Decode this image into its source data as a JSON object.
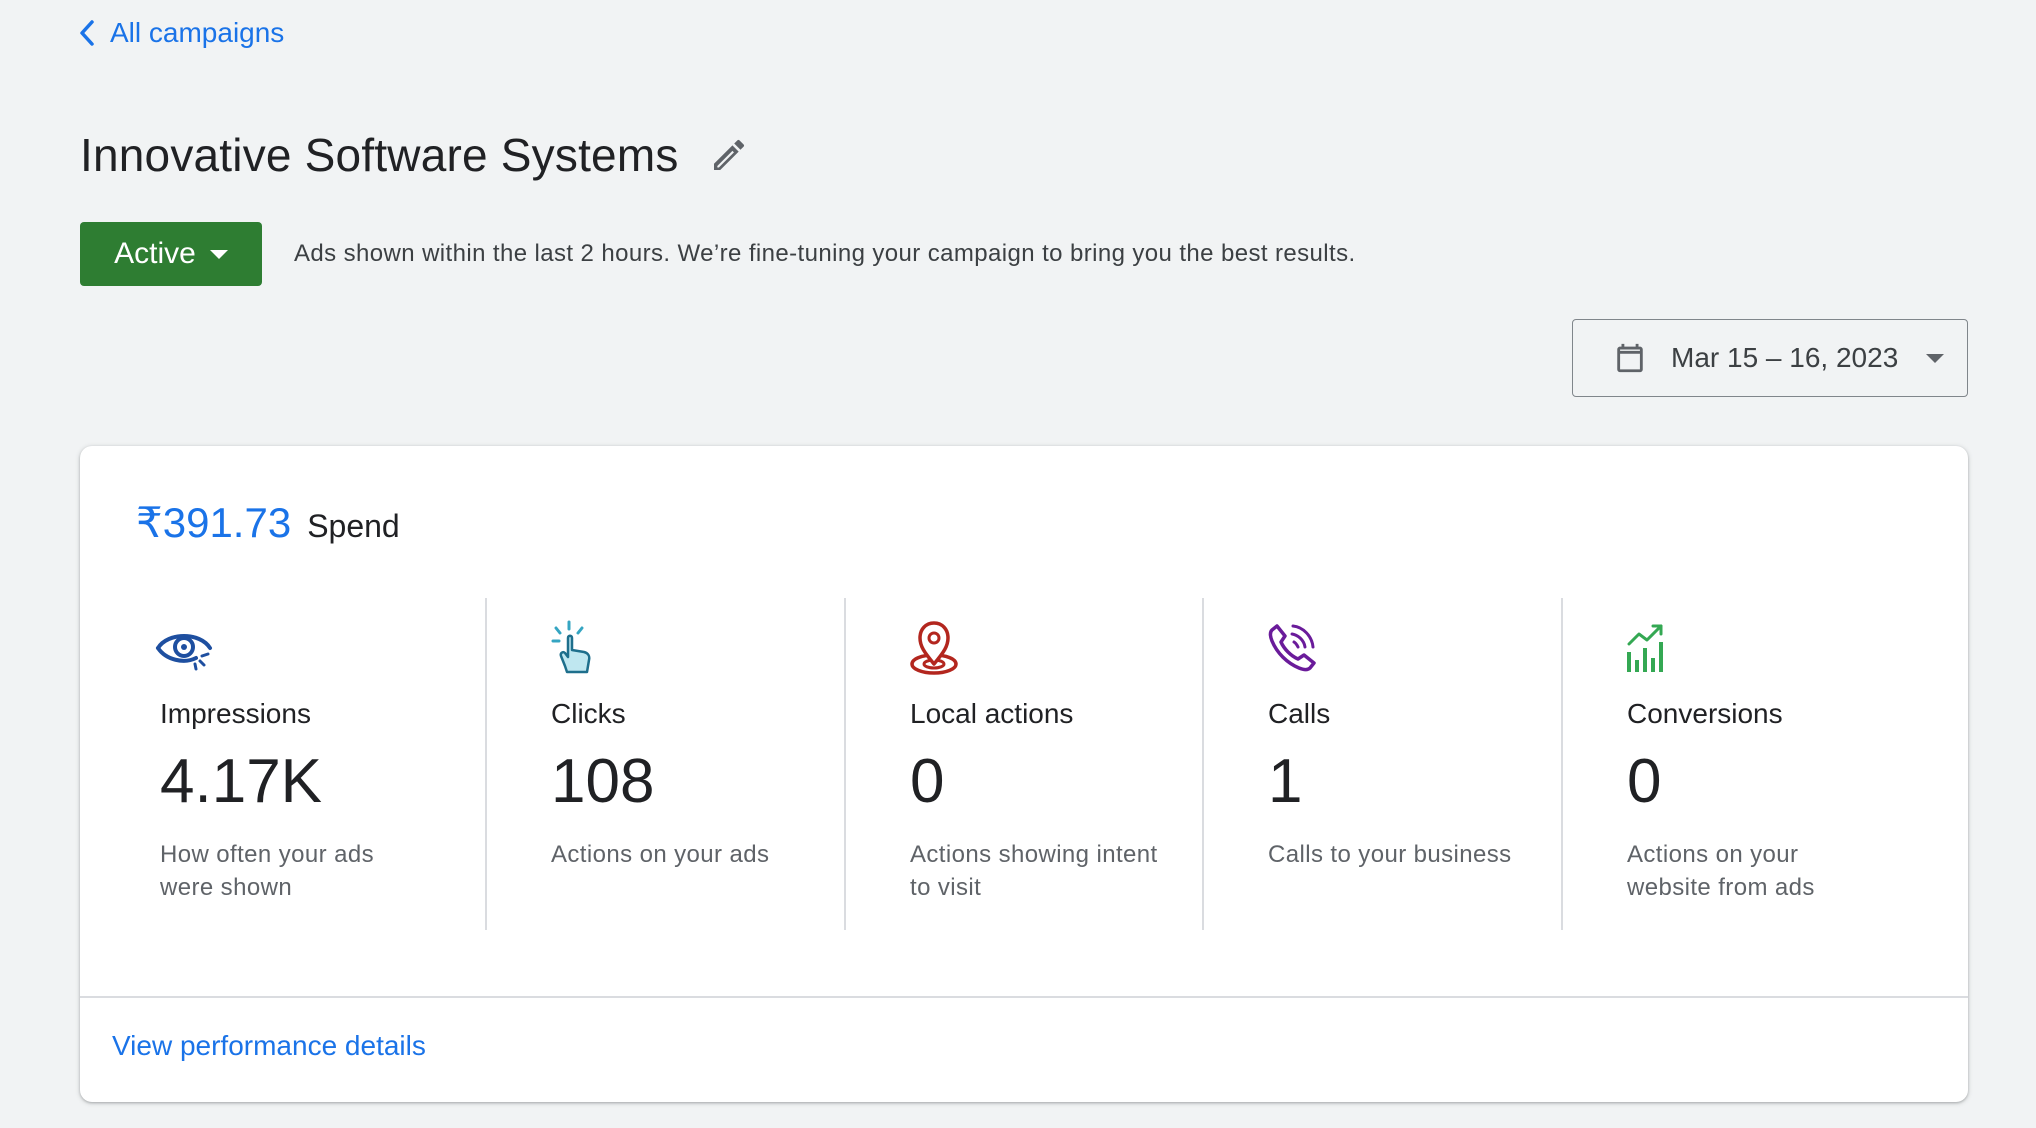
{
  "nav": {
    "back_label": "All campaigns"
  },
  "campaign": {
    "title": "Innovative Software Systems",
    "status": "Active",
    "status_message": "Ads shown within the last 2 hours. We’re fine-tuning your campaign to bring you the best results."
  },
  "date_range": {
    "label": "Mar 15 – 16, 2023"
  },
  "summary": {
    "spend_value": "₹391.73",
    "spend_label": "Spend",
    "metrics": [
      {
        "label": "Impressions",
        "value": "4.17K",
        "description": "How often your ads were shown",
        "icon": "eye-icon",
        "color": "#1e4fa0"
      },
      {
        "label": "Clicks",
        "value": "108",
        "description": "Actions on your ads",
        "icon": "click-hand-icon",
        "color": "#35a5c2"
      },
      {
        "label": "Local actions",
        "value": "0",
        "description": "Actions showing intent to visit",
        "icon": "location-pin-icon",
        "color": "#b3261e"
      },
      {
        "label": "Calls",
        "value": "1",
        "description": "Calls to your business",
        "icon": "phone-icon",
        "color": "#6a1b9a"
      },
      {
        "label": "Conversions",
        "value": "0",
        "description": "Actions on your website from ads",
        "icon": "trending-chart-icon",
        "color": "#34a853"
      }
    ],
    "view_details_label": "View performance details"
  },
  "colors": {
    "accent": "#1a73e8",
    "status_green": "#2e7d32"
  }
}
